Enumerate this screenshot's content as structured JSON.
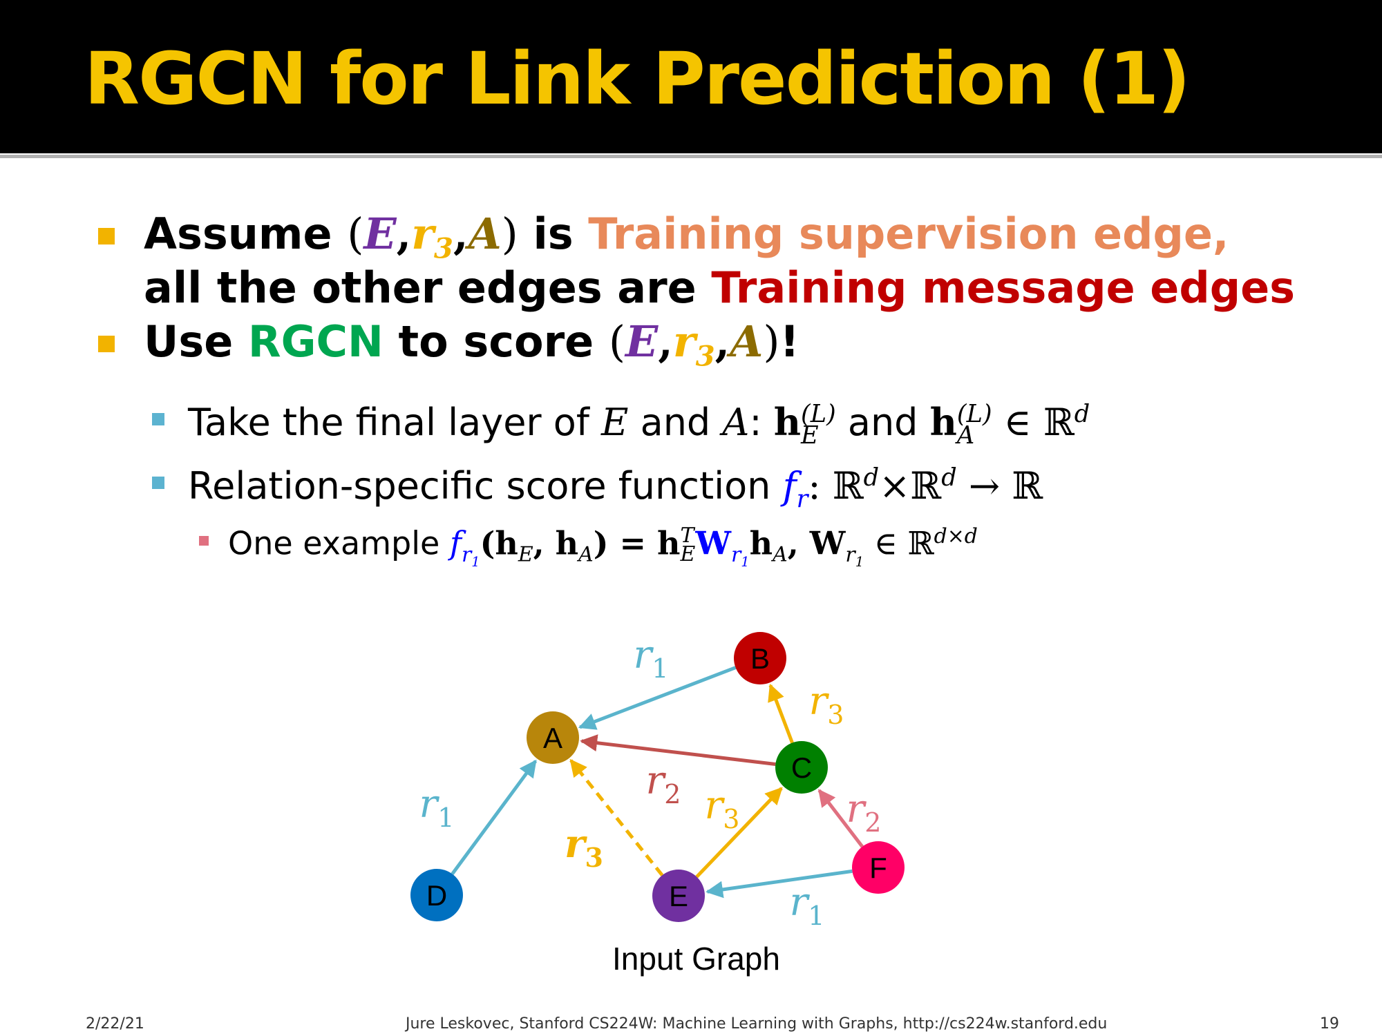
{
  "title": "RGCN for Link Prediction (1)",
  "bullets": {
    "b1_assume": "Assume",
    "b1_tuple_open": "(",
    "b1_E": "E",
    "b1_comma1": ",",
    "b1_r": "r",
    "b1_r_sub": "3",
    "b1_comma2": ",",
    "b1_A": "A",
    "b1_tuple_close": ")",
    "b1_is": "is",
    "b1_training_supervision": "Training supervision edge,",
    "b1_line2_start": "all the other edges are",
    "b1_training_message": "Training message edges",
    "b2_use": "Use",
    "b2_rgcn": "RGCN",
    "b2_to_score": "to score",
    "b2_bang": "!",
    "s1_text": "Take the final layer of",
    "s1_E": "E",
    "s1_and": "and",
    "s1_A": "A",
    "s1_colon": ":",
    "s1_h": "h",
    "s1_and2": "and",
    "s1_in": "∈ ℝ",
    "s1_sup_L": "(L)",
    "s1_sub_E": "E",
    "s1_sub_A": "A",
    "s1_sup_d": "d",
    "s2_text": "Relation-specific score function",
    "s2_f": "f",
    "s2_f_sub": "r",
    "s2_rest": ": ℝ",
    "s2_d1": "d",
    "s2_times": "×ℝ",
    "s2_d2": "d",
    "s2_arrow": " → ℝ",
    "ss1_text": "One example",
    "ss1_eq": "(h",
    "ss1_subE": "E",
    "ss1_comma": ", h",
    "ss1_subA": "A",
    "ss1_equals": ") = h",
    "ss1_supT": "T",
    "ss1_W": "W",
    "ss1_h": "h",
    "ss1_W2": ", W",
    "ss1_in": "∈ ℝ",
    "ss1_dxd": "d×d",
    "r1_sub": "r",
    "one": "1"
  },
  "graph": {
    "caption": "Input Graph",
    "nodes": [
      {
        "id": "A",
        "color": "#b8860b"
      },
      {
        "id": "B",
        "color": "#c00000"
      },
      {
        "id": "C",
        "color": "#008000"
      },
      {
        "id": "D",
        "color": "#0070c0"
      },
      {
        "id": "E",
        "color": "#7030a0"
      },
      {
        "id": "F",
        "color": "#ff0066"
      }
    ],
    "edges": [
      {
        "from": "B",
        "to": "A",
        "label": "r",
        "sub": "1",
        "color": "#5ab4cc",
        "style": "solid"
      },
      {
        "from": "C",
        "to": "B",
        "label": "r",
        "sub": "3",
        "color": "#f2b300",
        "style": "solid"
      },
      {
        "from": "C",
        "to": "A",
        "label": "r",
        "sub": "2",
        "color": "#c0504d",
        "style": "solid"
      },
      {
        "from": "D",
        "to": "A",
        "label": "r",
        "sub": "1",
        "color": "#5ab4cc",
        "style": "solid"
      },
      {
        "from": "E",
        "to": "A",
        "label": "r",
        "sub": "3",
        "color": "#f2b300",
        "style": "dashed"
      },
      {
        "from": "E",
        "to": "C",
        "label": "r",
        "sub": "3",
        "color": "#f2b300",
        "style": "solid"
      },
      {
        "from": "F",
        "to": "C",
        "label": "r",
        "sub": "2",
        "color": "#e07080",
        "style": "solid"
      },
      {
        "from": "F",
        "to": "E",
        "label": "r",
        "sub": "1",
        "color": "#5ab4cc",
        "style": "solid"
      }
    ]
  },
  "footer": {
    "date": "2/22/21",
    "credit": "Jure Leskovec, Stanford CS224W: Machine Learning with Graphs, http://cs224w.stanford.edu",
    "page": "19"
  }
}
